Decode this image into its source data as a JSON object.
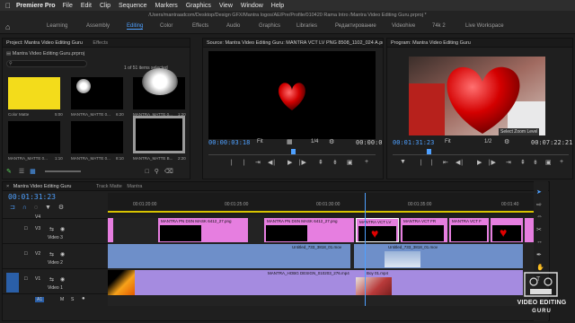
{
  "menu": {
    "apple": "",
    "app": "Premiere Pro",
    "items": [
      "File",
      "Edit",
      "Clip",
      "Sequence",
      "Markers",
      "Graphics",
      "View",
      "Window",
      "Help"
    ]
  },
  "path": "/Users/mantraadcom/Desktop/Design GFX/Mantra logos/AE/Pre/Profile/010420 Rama Intro /Mantra Video Editing Guru.prproj *",
  "workspaces": [
    "Learning",
    "Assembly",
    "Editing",
    "Color",
    "Effects",
    "Audio",
    "Graphics",
    "Libraries",
    "Редактирование",
    "Videohive",
    "74k 2",
    "Live Workspace"
  ],
  "workspace_active": "Editing",
  "project": {
    "tab": "Project: Mantra Video Editing Guru",
    "tab2": "Effects",
    "file": "Mantra Video Editing Guru.prproj",
    "count": "1 of 51 items selected",
    "items": [
      {
        "name": "Color Matte",
        "dur": "5:00"
      },
      {
        "name": "MANTRA_MATTE 0...",
        "dur": "6:20"
      },
      {
        "name": "MANTRA_MATTE 0...",
        "dur": "1:20"
      },
      {
        "name": "MANTRA_MATTE 0...",
        "dur": "1:10"
      },
      {
        "name": "MANTRA_MATTE 0...",
        "dur": "8:10"
      },
      {
        "name": "MANTRA_MATTE B...",
        "dur": "2:20"
      }
    ]
  },
  "source": {
    "title": "Source: Mantra Video Editing Guru:  MANTRA VCT LV PNG 8508_1102_024 A.png",
    "timecode": "00:00:03:18",
    "fit": "Fit",
    "fraction": "1/4",
    "end": "00:00:0"
  },
  "program": {
    "title": "Program: Mantra Video Editing Guru",
    "timecode": "00:01:31:23",
    "fit": "Fit",
    "fraction": "1/2",
    "end": "00:07:22:21",
    "tooltip": "Select Zoom Level"
  },
  "timeline": {
    "tab": "Mantra Video Editing Guru",
    "track_matte": "Track Matte",
    "track_matte_value": "Mantra",
    "timecode": "00:01:31:23",
    "ruler": [
      "00:01:20:00",
      "00:01:25:00",
      "00:01:30:00",
      "00:01:35:00",
      "00:01:40"
    ],
    "tracks": [
      {
        "id": "V4",
        "name": ""
      },
      {
        "id": "V3",
        "name": "Video 3"
      },
      {
        "id": "V2",
        "name": "Video 2"
      },
      {
        "id": "V1",
        "name": "Video 1"
      },
      {
        "id": "A1",
        "name": ""
      }
    ],
    "clips": {
      "v3a": "MANTRA PN DSN MASK 6412_27.png",
      "v3b": "MANTRA PN DSN MASK 6412_27.png",
      "v3c": "MANTRA VCT LV",
      "v3d": "MANTRA VCT FR",
      "v3e": "MANTRA VCT F",
      "v2a": "Untitled_733_3818_01.mov",
      "v2b": "Untitled_733_3818_01.mov",
      "v1a": "MANTRA_HOBG DESIGN_010203_276.mp4",
      "v1b": "Boy 01.mp4"
    }
  },
  "watermark": {
    "line1": "VIDEO EDITING",
    "line2": "GURU"
  },
  "colors": {
    "accent": "#4ea0ff",
    "clip_pink": "#e67ee0",
    "clip_blue": "#6e8fc9",
    "clip_lavender": "#a58be0",
    "matte_yellow": "#f3dc1b"
  }
}
